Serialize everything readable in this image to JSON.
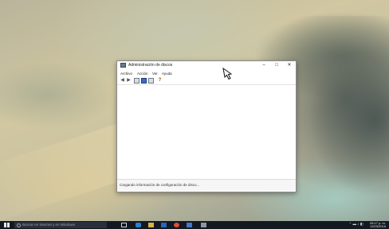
{
  "window": {
    "title": "Administración de discos",
    "minimize_symbol": "–",
    "maximize_symbol": "□",
    "close_symbol": "✕"
  },
  "menu": {
    "items": [
      "Archivo",
      "Acción",
      "Ver",
      "Ayuda"
    ]
  },
  "toolbar": {
    "back_symbol": "◀",
    "forward_symbol": "▶",
    "help_symbol": "?"
  },
  "statusbar": {
    "text": "Cargando información de configuración de disco..."
  },
  "taskbar": {
    "search_placeholder": "Buscar en Internet y en Windows",
    "tray_symbols": "⌃ ▬ ♪ ◧",
    "clock_time": "05:17 p. m.",
    "clock_date": "12/03/2016"
  }
}
